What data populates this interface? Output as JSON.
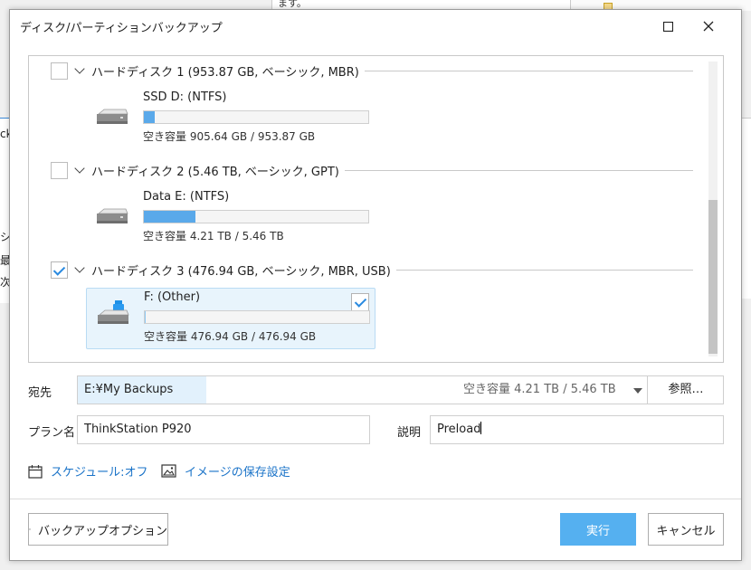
{
  "background": {
    "top_fragment_text": "ます。",
    "left_fragment_chars": [
      "ck",
      "シ",
      "最",
      "次"
    ]
  },
  "dialog": {
    "title": "ディスク/パーティションバックアップ",
    "maximize_symbol": "☐",
    "close_symbol": "✕"
  },
  "disks": [
    {
      "title": "ハードディスク 1 (953.87 GB, ベーシック, MBR)",
      "checked": false,
      "partition": {
        "name": "SSD D: (NTFS)",
        "free": "空き容量 905.64 GB / 953.87 GB",
        "used_fraction": 0.05,
        "icon": "hdd-icon"
      }
    },
    {
      "title": "ハードディスク 2 (5.46 TB, ベーシック, GPT)",
      "checked": false,
      "partition": {
        "name": "Data E: (NTFS)",
        "free": "空き容量 4.21 TB / 5.46 TB",
        "used_fraction": 0.23,
        "icon": "hdd-icon"
      }
    },
    {
      "title": "ハードディスク 3 (476.94 GB, ベーシック, MBR, USB)",
      "checked": true,
      "partition": {
        "name": "F: (Other)",
        "free": "空き容量 476.94 GB / 476.94 GB",
        "used_fraction": 0.0,
        "icon": "usb-drive-icon",
        "selected": true
      }
    }
  ],
  "destination": {
    "label": "宛先",
    "value": "E:¥My Backups",
    "free": "空き容量 4.21 TB / 5.46 TB",
    "browse_label": "参照…"
  },
  "plan": {
    "label": "プラン名",
    "value": "ThinkStation P920"
  },
  "description": {
    "label": "説明",
    "value": "Preload"
  },
  "links": {
    "schedule": "スケジュール:オフ",
    "image_settings": "イメージの保存設定"
  },
  "footer": {
    "backup_options": "バックアップオプション",
    "run": "実行",
    "cancel": "キャンセル"
  },
  "colors": {
    "accent": "#55b0f0",
    "link": "#1a73c8",
    "bar_fill": "#5aa9ea",
    "selected_bg": "#e8f4fc"
  }
}
